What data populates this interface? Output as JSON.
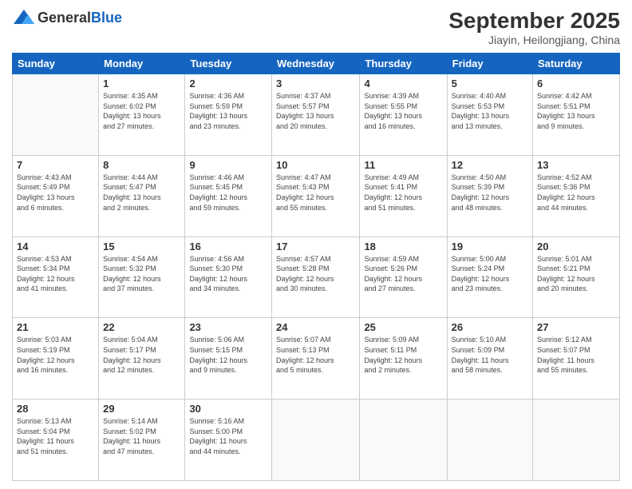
{
  "header": {
    "logo_general": "General",
    "logo_blue": "Blue",
    "month": "September 2025",
    "location": "Jiayin, Heilongjiang, China"
  },
  "weekdays": [
    "Sunday",
    "Monday",
    "Tuesday",
    "Wednesday",
    "Thursday",
    "Friday",
    "Saturday"
  ],
  "weeks": [
    [
      {
        "day": "",
        "info": ""
      },
      {
        "day": "1",
        "info": "Sunrise: 4:35 AM\nSunset: 6:02 PM\nDaylight: 13 hours\nand 27 minutes."
      },
      {
        "day": "2",
        "info": "Sunrise: 4:36 AM\nSunset: 5:59 PM\nDaylight: 13 hours\nand 23 minutes."
      },
      {
        "day": "3",
        "info": "Sunrise: 4:37 AM\nSunset: 5:57 PM\nDaylight: 13 hours\nand 20 minutes."
      },
      {
        "day": "4",
        "info": "Sunrise: 4:39 AM\nSunset: 5:55 PM\nDaylight: 13 hours\nand 16 minutes."
      },
      {
        "day": "5",
        "info": "Sunrise: 4:40 AM\nSunset: 5:53 PM\nDaylight: 13 hours\nand 13 minutes."
      },
      {
        "day": "6",
        "info": "Sunrise: 4:42 AM\nSunset: 5:51 PM\nDaylight: 13 hours\nand 9 minutes."
      }
    ],
    [
      {
        "day": "7",
        "info": "Sunrise: 4:43 AM\nSunset: 5:49 PM\nDaylight: 13 hours\nand 6 minutes."
      },
      {
        "day": "8",
        "info": "Sunrise: 4:44 AM\nSunset: 5:47 PM\nDaylight: 13 hours\nand 2 minutes."
      },
      {
        "day": "9",
        "info": "Sunrise: 4:46 AM\nSunset: 5:45 PM\nDaylight: 12 hours\nand 59 minutes."
      },
      {
        "day": "10",
        "info": "Sunrise: 4:47 AM\nSunset: 5:43 PM\nDaylight: 12 hours\nand 55 minutes."
      },
      {
        "day": "11",
        "info": "Sunrise: 4:49 AM\nSunset: 5:41 PM\nDaylight: 12 hours\nand 51 minutes."
      },
      {
        "day": "12",
        "info": "Sunrise: 4:50 AM\nSunset: 5:39 PM\nDaylight: 12 hours\nand 48 minutes."
      },
      {
        "day": "13",
        "info": "Sunrise: 4:52 AM\nSunset: 5:36 PM\nDaylight: 12 hours\nand 44 minutes."
      }
    ],
    [
      {
        "day": "14",
        "info": "Sunrise: 4:53 AM\nSunset: 5:34 PM\nDaylight: 12 hours\nand 41 minutes."
      },
      {
        "day": "15",
        "info": "Sunrise: 4:54 AM\nSunset: 5:32 PM\nDaylight: 12 hours\nand 37 minutes."
      },
      {
        "day": "16",
        "info": "Sunrise: 4:56 AM\nSunset: 5:30 PM\nDaylight: 12 hours\nand 34 minutes."
      },
      {
        "day": "17",
        "info": "Sunrise: 4:57 AM\nSunset: 5:28 PM\nDaylight: 12 hours\nand 30 minutes."
      },
      {
        "day": "18",
        "info": "Sunrise: 4:59 AM\nSunset: 5:26 PM\nDaylight: 12 hours\nand 27 minutes."
      },
      {
        "day": "19",
        "info": "Sunrise: 5:00 AM\nSunset: 5:24 PM\nDaylight: 12 hours\nand 23 minutes."
      },
      {
        "day": "20",
        "info": "Sunrise: 5:01 AM\nSunset: 5:21 PM\nDaylight: 12 hours\nand 20 minutes."
      }
    ],
    [
      {
        "day": "21",
        "info": "Sunrise: 5:03 AM\nSunset: 5:19 PM\nDaylight: 12 hours\nand 16 minutes."
      },
      {
        "day": "22",
        "info": "Sunrise: 5:04 AM\nSunset: 5:17 PM\nDaylight: 12 hours\nand 12 minutes."
      },
      {
        "day": "23",
        "info": "Sunrise: 5:06 AM\nSunset: 5:15 PM\nDaylight: 12 hours\nand 9 minutes."
      },
      {
        "day": "24",
        "info": "Sunrise: 5:07 AM\nSunset: 5:13 PM\nDaylight: 12 hours\nand 5 minutes."
      },
      {
        "day": "25",
        "info": "Sunrise: 5:09 AM\nSunset: 5:11 PM\nDaylight: 12 hours\nand 2 minutes."
      },
      {
        "day": "26",
        "info": "Sunrise: 5:10 AM\nSunset: 5:09 PM\nDaylight: 11 hours\nand 58 minutes."
      },
      {
        "day": "27",
        "info": "Sunrise: 5:12 AM\nSunset: 5:07 PM\nDaylight: 11 hours\nand 55 minutes."
      }
    ],
    [
      {
        "day": "28",
        "info": "Sunrise: 5:13 AM\nSunset: 5:04 PM\nDaylight: 11 hours\nand 51 minutes."
      },
      {
        "day": "29",
        "info": "Sunrise: 5:14 AM\nSunset: 5:02 PM\nDaylight: 11 hours\nand 47 minutes."
      },
      {
        "day": "30",
        "info": "Sunrise: 5:16 AM\nSunset: 5:00 PM\nDaylight: 11 hours\nand 44 minutes."
      },
      {
        "day": "",
        "info": ""
      },
      {
        "day": "",
        "info": ""
      },
      {
        "day": "",
        "info": ""
      },
      {
        "day": "",
        "info": ""
      }
    ]
  ]
}
